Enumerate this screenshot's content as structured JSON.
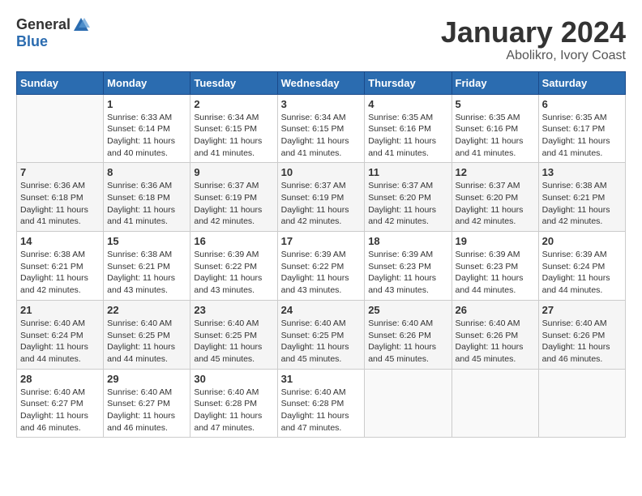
{
  "header": {
    "logo_general": "General",
    "logo_blue": "Blue",
    "month_title": "January 2024",
    "subtitle": "Abolikro, Ivory Coast"
  },
  "calendar": {
    "days_of_week": [
      "Sunday",
      "Monday",
      "Tuesday",
      "Wednesday",
      "Thursday",
      "Friday",
      "Saturday"
    ],
    "weeks": [
      [
        {
          "day": "",
          "info": ""
        },
        {
          "day": "1",
          "info": "Sunrise: 6:33 AM\nSunset: 6:14 PM\nDaylight: 11 hours\nand 40 minutes."
        },
        {
          "day": "2",
          "info": "Sunrise: 6:34 AM\nSunset: 6:15 PM\nDaylight: 11 hours\nand 41 minutes."
        },
        {
          "day": "3",
          "info": "Sunrise: 6:34 AM\nSunset: 6:15 PM\nDaylight: 11 hours\nand 41 minutes."
        },
        {
          "day": "4",
          "info": "Sunrise: 6:35 AM\nSunset: 6:16 PM\nDaylight: 11 hours\nand 41 minutes."
        },
        {
          "day": "5",
          "info": "Sunrise: 6:35 AM\nSunset: 6:16 PM\nDaylight: 11 hours\nand 41 minutes."
        },
        {
          "day": "6",
          "info": "Sunrise: 6:35 AM\nSunset: 6:17 PM\nDaylight: 11 hours\nand 41 minutes."
        }
      ],
      [
        {
          "day": "7",
          "info": "Sunrise: 6:36 AM\nSunset: 6:18 PM\nDaylight: 11 hours\nand 41 minutes."
        },
        {
          "day": "8",
          "info": "Sunrise: 6:36 AM\nSunset: 6:18 PM\nDaylight: 11 hours\nand 41 minutes."
        },
        {
          "day": "9",
          "info": "Sunrise: 6:37 AM\nSunset: 6:19 PM\nDaylight: 11 hours\nand 42 minutes."
        },
        {
          "day": "10",
          "info": "Sunrise: 6:37 AM\nSunset: 6:19 PM\nDaylight: 11 hours\nand 42 minutes."
        },
        {
          "day": "11",
          "info": "Sunrise: 6:37 AM\nSunset: 6:20 PM\nDaylight: 11 hours\nand 42 minutes."
        },
        {
          "day": "12",
          "info": "Sunrise: 6:37 AM\nSunset: 6:20 PM\nDaylight: 11 hours\nand 42 minutes."
        },
        {
          "day": "13",
          "info": "Sunrise: 6:38 AM\nSunset: 6:21 PM\nDaylight: 11 hours\nand 42 minutes."
        }
      ],
      [
        {
          "day": "14",
          "info": "Sunrise: 6:38 AM\nSunset: 6:21 PM\nDaylight: 11 hours\nand 42 minutes."
        },
        {
          "day": "15",
          "info": "Sunrise: 6:38 AM\nSunset: 6:21 PM\nDaylight: 11 hours\nand 43 minutes."
        },
        {
          "day": "16",
          "info": "Sunrise: 6:39 AM\nSunset: 6:22 PM\nDaylight: 11 hours\nand 43 minutes."
        },
        {
          "day": "17",
          "info": "Sunrise: 6:39 AM\nSunset: 6:22 PM\nDaylight: 11 hours\nand 43 minutes."
        },
        {
          "day": "18",
          "info": "Sunrise: 6:39 AM\nSunset: 6:23 PM\nDaylight: 11 hours\nand 43 minutes."
        },
        {
          "day": "19",
          "info": "Sunrise: 6:39 AM\nSunset: 6:23 PM\nDaylight: 11 hours\nand 44 minutes."
        },
        {
          "day": "20",
          "info": "Sunrise: 6:39 AM\nSunset: 6:24 PM\nDaylight: 11 hours\nand 44 minutes."
        }
      ],
      [
        {
          "day": "21",
          "info": "Sunrise: 6:40 AM\nSunset: 6:24 PM\nDaylight: 11 hours\nand 44 minutes."
        },
        {
          "day": "22",
          "info": "Sunrise: 6:40 AM\nSunset: 6:25 PM\nDaylight: 11 hours\nand 44 minutes."
        },
        {
          "day": "23",
          "info": "Sunrise: 6:40 AM\nSunset: 6:25 PM\nDaylight: 11 hours\nand 45 minutes."
        },
        {
          "day": "24",
          "info": "Sunrise: 6:40 AM\nSunset: 6:25 PM\nDaylight: 11 hours\nand 45 minutes."
        },
        {
          "day": "25",
          "info": "Sunrise: 6:40 AM\nSunset: 6:26 PM\nDaylight: 11 hours\nand 45 minutes."
        },
        {
          "day": "26",
          "info": "Sunrise: 6:40 AM\nSunset: 6:26 PM\nDaylight: 11 hours\nand 45 minutes."
        },
        {
          "day": "27",
          "info": "Sunrise: 6:40 AM\nSunset: 6:26 PM\nDaylight: 11 hours\nand 46 minutes."
        }
      ],
      [
        {
          "day": "28",
          "info": "Sunrise: 6:40 AM\nSunset: 6:27 PM\nDaylight: 11 hours\nand 46 minutes."
        },
        {
          "day": "29",
          "info": "Sunrise: 6:40 AM\nSunset: 6:27 PM\nDaylight: 11 hours\nand 46 minutes."
        },
        {
          "day": "30",
          "info": "Sunrise: 6:40 AM\nSunset: 6:28 PM\nDaylight: 11 hours\nand 47 minutes."
        },
        {
          "day": "31",
          "info": "Sunrise: 6:40 AM\nSunset: 6:28 PM\nDaylight: 11 hours\nand 47 minutes."
        },
        {
          "day": "",
          "info": ""
        },
        {
          "day": "",
          "info": ""
        },
        {
          "day": "",
          "info": ""
        }
      ]
    ]
  }
}
